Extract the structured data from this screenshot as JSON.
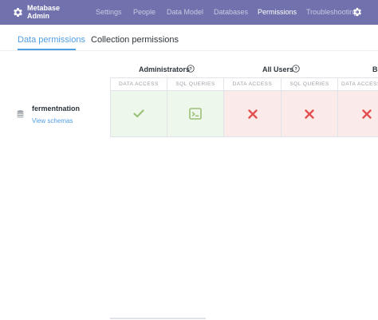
{
  "brand": {
    "line1": "Metabase",
    "line2": "Admin"
  },
  "nav": {
    "items": [
      {
        "label": "Settings",
        "active": false
      },
      {
        "label": "People",
        "active": false
      },
      {
        "label": "Data Model",
        "active": false
      },
      {
        "label": "Databases",
        "active": false
      },
      {
        "label": "Permissions",
        "active": true
      },
      {
        "label": "Troubleshooting",
        "active": false
      }
    ]
  },
  "tabs": [
    {
      "label": "Data permissions",
      "active": true
    },
    {
      "label": "Collection permissions",
      "active": false
    }
  ],
  "groups": [
    {
      "name": "Administrators",
      "help": "?"
    },
    {
      "name": "All Users",
      "help": "?"
    },
    {
      "name": "B"
    }
  ],
  "columns": {
    "data_access": "DATA ACCESS",
    "sql_queries": "SQL QUERIES"
  },
  "database": {
    "name": "fermentnation",
    "link": "View schemas"
  },
  "cells": [
    {
      "group": "Administrators",
      "column": "DATA ACCESS",
      "state": "granted",
      "icon": "check-icon"
    },
    {
      "group": "Administrators",
      "column": "SQL QUERIES",
      "state": "granted",
      "icon": "sql-editor-icon"
    },
    {
      "group": "All Users",
      "column": "DATA ACCESS",
      "state": "denied",
      "icon": "close-icon"
    },
    {
      "group": "All Users",
      "column": "SQL QUERIES",
      "state": "denied",
      "icon": "close-icon"
    },
    {
      "group": "B",
      "column": "DATA ACCESS",
      "state": "denied",
      "icon": "close-icon"
    }
  ],
  "colors": {
    "nav_bg": "#7172ad",
    "accent": "#509ee3",
    "granted_bg": "#eef7ec",
    "granted_icon": "#9cc177",
    "denied_bg": "#fbeaea",
    "denied_icon": "#e35050"
  }
}
